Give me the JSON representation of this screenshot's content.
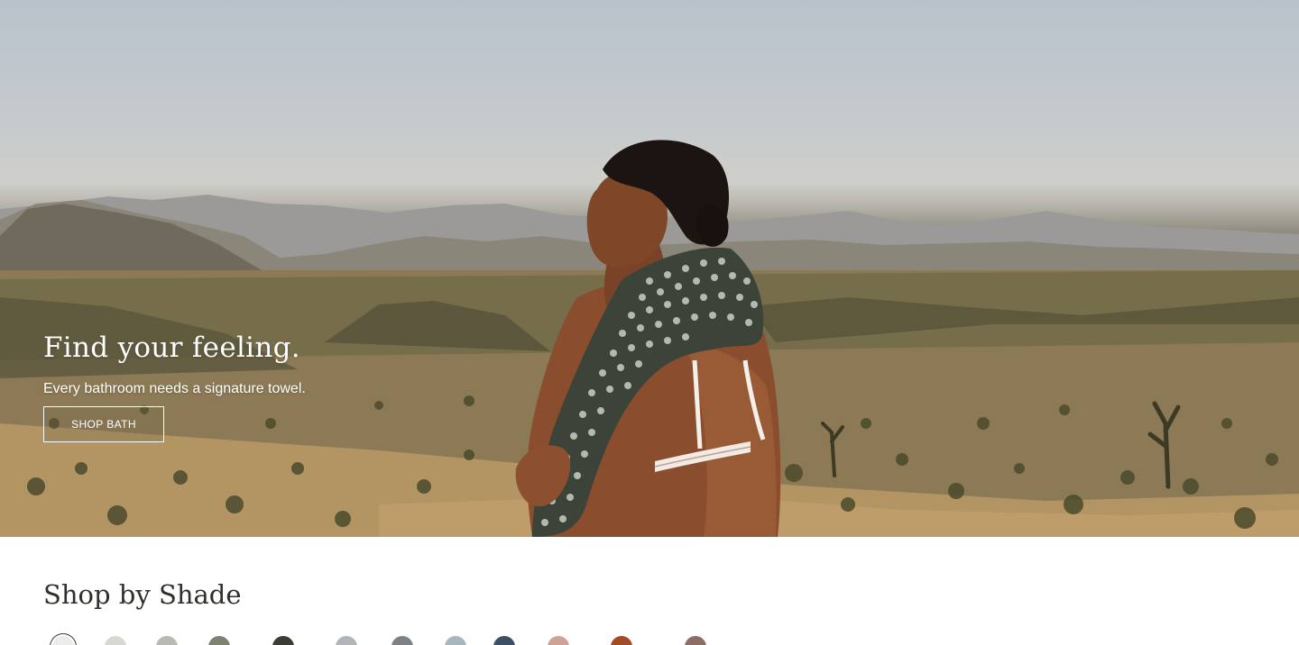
{
  "hero": {
    "title": "Find your feeling.",
    "subtitle": "Every bathroom needs a signature towel.",
    "cta_label": "SHOP BATH"
  },
  "shade_section": {
    "title": "Shop by Shade",
    "swatches": [
      {
        "color": "#ececea",
        "selected": true
      },
      {
        "color": "#d7d7d3",
        "selected": false
      },
      {
        "color": "#b9bab2",
        "selected": false
      },
      {
        "color": "#7d8370",
        "selected": false
      },
      {
        "color": "#3b3d35",
        "selected": false
      },
      {
        "color": "#b2b5b7",
        "selected": false
      },
      {
        "color": "#7e8285",
        "selected": false
      },
      {
        "color": "#a9b7bd",
        "selected": false
      },
      {
        "color": "#3e4e63",
        "selected": false
      },
      {
        "color": "#cda297",
        "selected": false
      },
      {
        "color": "#a24c25",
        "selected": false
      },
      {
        "color": "#8a6f66",
        "selected": false
      }
    ]
  }
}
